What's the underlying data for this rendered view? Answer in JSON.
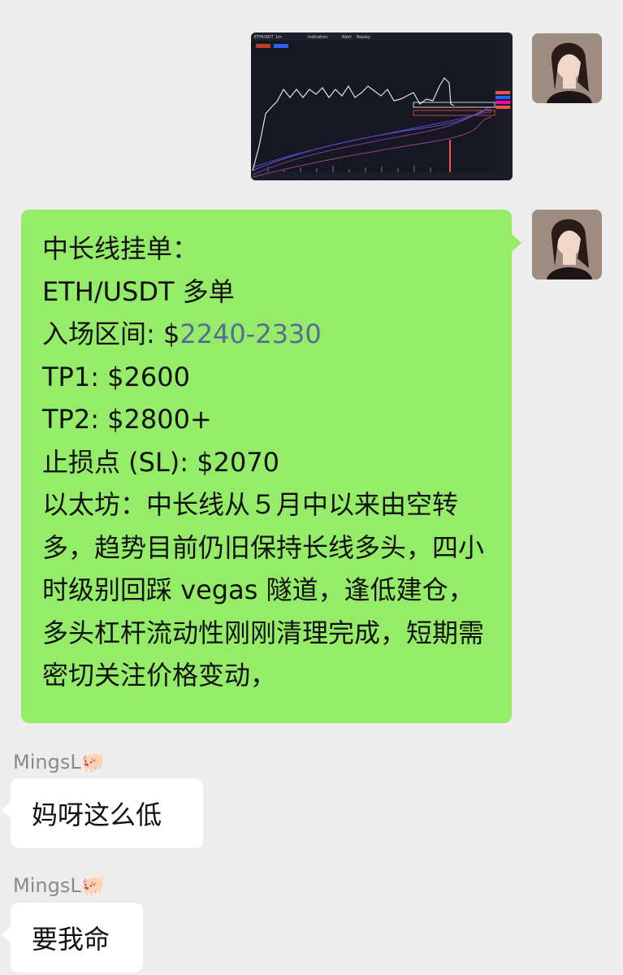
{
  "messages": {
    "chart_image": {
      "toolbar_items": [
        "ETHUSDT",
        "1m",
        "Indicators",
        "Alert",
        "Replay"
      ],
      "series_line": "#e0e0e0",
      "up_color": "#26a69a",
      "down_color": "#ef5350"
    },
    "signal": {
      "lines": [
        "中长线挂单：",
        "ETH/USDT  多单",
        "入场区间: $",
        "TP1: $2600",
        "TP2: $2800+",
        "止损点 (SL): $2070"
      ],
      "entry_range_link": "2240-2330",
      "analysis": "以太坊：中长线从５月中以来由空转多，趋势目前仍旧保持长线多头，四小时级别回踩 vegas 隧道，逢低建仓，多头杠杆流动性刚刚清理完成，短期需密切关注价格变动，"
    },
    "reply1": {
      "sender": "MingsL🐖",
      "text": "妈呀这么低"
    },
    "reply2": {
      "sender": "MingsL🐖",
      "text": "要我命"
    }
  },
  "colors": {
    "background": "#ededed",
    "self_bubble": "#95ec69",
    "other_bubble": "#ffffff",
    "link": "#576b95",
    "sender_name": "#8a8a8a"
  }
}
